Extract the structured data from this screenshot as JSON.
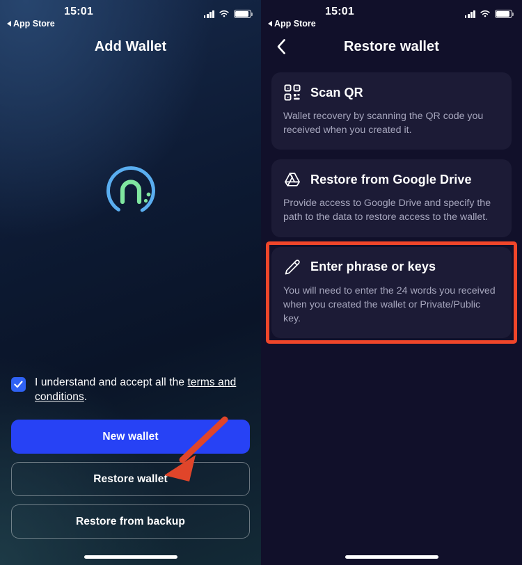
{
  "screens": [
    {
      "id": "add-wallet",
      "status_bar": {
        "time": "15:01",
        "back_label": "App Store",
        "signal_icon": "cellular-signal-icon",
        "wifi_icon": "wifi-icon",
        "battery_icon": "battery-icon"
      },
      "nav": {
        "title": "Add Wallet"
      },
      "logo": {
        "name": "wallet-logo",
        "ring_color": "#5aaef0",
        "mark_color": "#7fe6a0"
      },
      "terms": {
        "checked": true,
        "text_before": "I understand and accept all the ",
        "link_text": "terms and conditions",
        "text_after": "."
      },
      "buttons": [
        {
          "id": "new-wallet",
          "label": "New wallet",
          "style": "primary"
        },
        {
          "id": "restore-wallet",
          "label": "Restore wallet",
          "style": "ghost"
        },
        {
          "id": "restore-from-backup",
          "label": "Restore from backup",
          "style": "ghost"
        }
      ]
    },
    {
      "id": "restore-wallet",
      "status_bar": {
        "time": "15:01",
        "back_label": "App Store",
        "signal_icon": "cellular-signal-icon",
        "wifi_icon": "wifi-icon",
        "battery_icon": "battery-icon"
      },
      "nav": {
        "title": "Restore wallet",
        "back_icon": "chevron-left-icon"
      },
      "cards": [
        {
          "id": "scan-qr",
          "icon": "qr-code-icon",
          "title": "Scan QR",
          "description": "Wallet recovery by scanning the QR code you received when you created it.",
          "highlighted": false
        },
        {
          "id": "restore-google-drive",
          "icon": "google-drive-icon",
          "title": "Restore from Google Drive",
          "description": "Provide access to Google Drive and specify the path to the data to restore access to the wallet.",
          "highlighted": false
        },
        {
          "id": "enter-phrase-or-keys",
          "icon": "pencil-icon",
          "title": "Enter phrase or keys",
          "description": "You will need to enter the 24 words you received when you created the wallet or Private/Public key.",
          "highlighted": true
        }
      ]
    }
  ],
  "annotations": {
    "arrow": {
      "name": "pointer-arrow",
      "color": "#e0452a",
      "target": "restore-wallet-button"
    },
    "highlight_box": {
      "name": "highlight-box",
      "color": "#f0462a",
      "target": "enter-phrase-or-keys"
    }
  }
}
